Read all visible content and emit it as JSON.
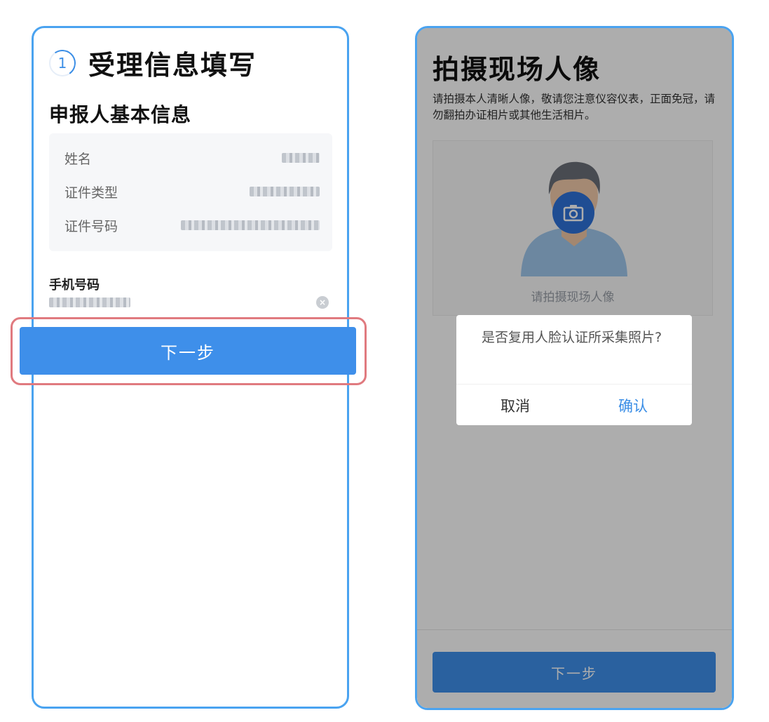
{
  "left": {
    "step_number": "1",
    "title": "受理信息填写",
    "section_title": "申报人基本信息",
    "info": [
      {
        "label": "姓名"
      },
      {
        "label": "证件类型"
      },
      {
        "label": "证件号码"
      }
    ],
    "phone_label": "手机号码",
    "next_label": "下一步"
  },
  "right": {
    "title": "拍摄现场人像",
    "description": "请拍摄本人清晰人像，敬请您注意仪容仪表，正面免冠，请勿翻拍办证相片或其他生活相片。",
    "photo_caption": "请拍摄现场人像",
    "next_label": "下一步",
    "dialog": {
      "message": "是否复用人脸认证所采集照片?",
      "cancel_label": "取消",
      "confirm_label": "确认"
    }
  },
  "colors": {
    "accent": "#3e8fea",
    "frame": "#4aa3f0",
    "highlight": "#e07a7f"
  }
}
